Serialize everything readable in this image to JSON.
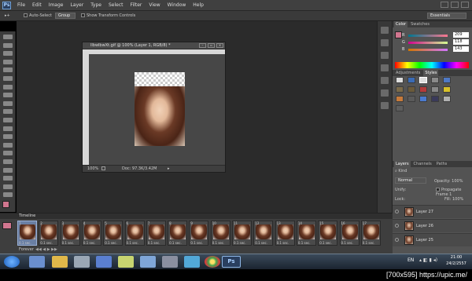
{
  "app": {
    "logo": "Ps"
  },
  "menu": [
    "File",
    "Edit",
    "Image",
    "Layer",
    "Type",
    "Select",
    "Filter",
    "View",
    "Window",
    "Help"
  ],
  "options": {
    "auto_select": "Auto-Select",
    "group": "Group",
    "show_transform": "Show Transform Controls",
    "workspace": "Essentials"
  },
  "document": {
    "title": "llbwlbwXt.gif @ 100% (Layer 1, RGB/8) *",
    "zoom": "100%",
    "doc_info": "Doc: 97.3K/3.42M"
  },
  "color_panel": {
    "tabs": [
      "Color",
      "Swatches"
    ],
    "rows": [
      {
        "label": "R",
        "value": "209"
      },
      {
        "label": "G",
        "value": "118"
      },
      {
        "label": "B",
        "value": "143"
      }
    ]
  },
  "adjustments_panel": {
    "tabs": [
      "Adjustments",
      "Styles"
    ]
  },
  "layers_panel": {
    "tabs": [
      "Layers",
      "Channels",
      "Paths"
    ],
    "kind": "Kind",
    "blend_mode": "Normal",
    "opacity_label": "Opacity:",
    "opacity_value": "100%",
    "unify_label": "Unify:",
    "propagate": "Propagate Frame 1",
    "lock_label": "Lock:",
    "fill_label": "Fill:",
    "fill_value": "100%",
    "layers": [
      "Layer 27",
      "Layer 26",
      "Layer 25"
    ]
  },
  "timeline": {
    "title": "Timeline",
    "loop": "Forever",
    "frames": [
      {
        "n": "1",
        "d": "0.1 sec."
      },
      {
        "n": "2",
        "d": "0.1 sec."
      },
      {
        "n": "3",
        "d": "0.1 sec."
      },
      {
        "n": "4",
        "d": "0.1 sec."
      },
      {
        "n": "5",
        "d": "0.1 sec."
      },
      {
        "n": "6",
        "d": "0.1 sec."
      },
      {
        "n": "7",
        "d": "0.1 sec."
      },
      {
        "n": "8",
        "d": "0.1 sec."
      },
      {
        "n": "9",
        "d": "0.1 sec."
      },
      {
        "n": "10",
        "d": "0.1 sec."
      },
      {
        "n": "11",
        "d": "0.1 sec."
      },
      {
        "n": "12",
        "d": "0.1 sec."
      },
      {
        "n": "13",
        "d": "0.1 sec."
      },
      {
        "n": "14",
        "d": "0.1 sec."
      },
      {
        "n": "15",
        "d": "0.1 sec."
      },
      {
        "n": "16",
        "d": "0.1 sec."
      },
      {
        "n": "17",
        "d": "0.1 sec."
      }
    ]
  },
  "taskbar": {
    "lang": "EN",
    "time": "21:00",
    "date": "24/2/2557",
    "app_badge": "Ps"
  },
  "watermark": "[700x595] https://upic.me/",
  "colors": {
    "fg_swatch": "#d1768f",
    "bg_swatch": "#ffffff"
  }
}
